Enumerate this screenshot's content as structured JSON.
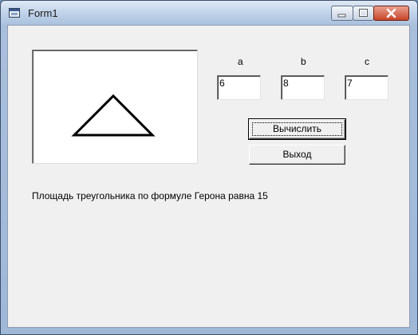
{
  "window": {
    "title": "Form1",
    "icon": "form-icon",
    "controls": [
      "minimize-icon",
      "maximize-icon",
      "close-icon"
    ]
  },
  "inputs": [
    {
      "label": "a",
      "value": "6"
    },
    {
      "label": "b",
      "value": "8"
    },
    {
      "label": "c",
      "value": "7"
    }
  ],
  "buttons": {
    "calculate": "Вычислить",
    "exit": "Выход"
  },
  "result_text": "Площадь треугольника по формуле Герона равна 15"
}
